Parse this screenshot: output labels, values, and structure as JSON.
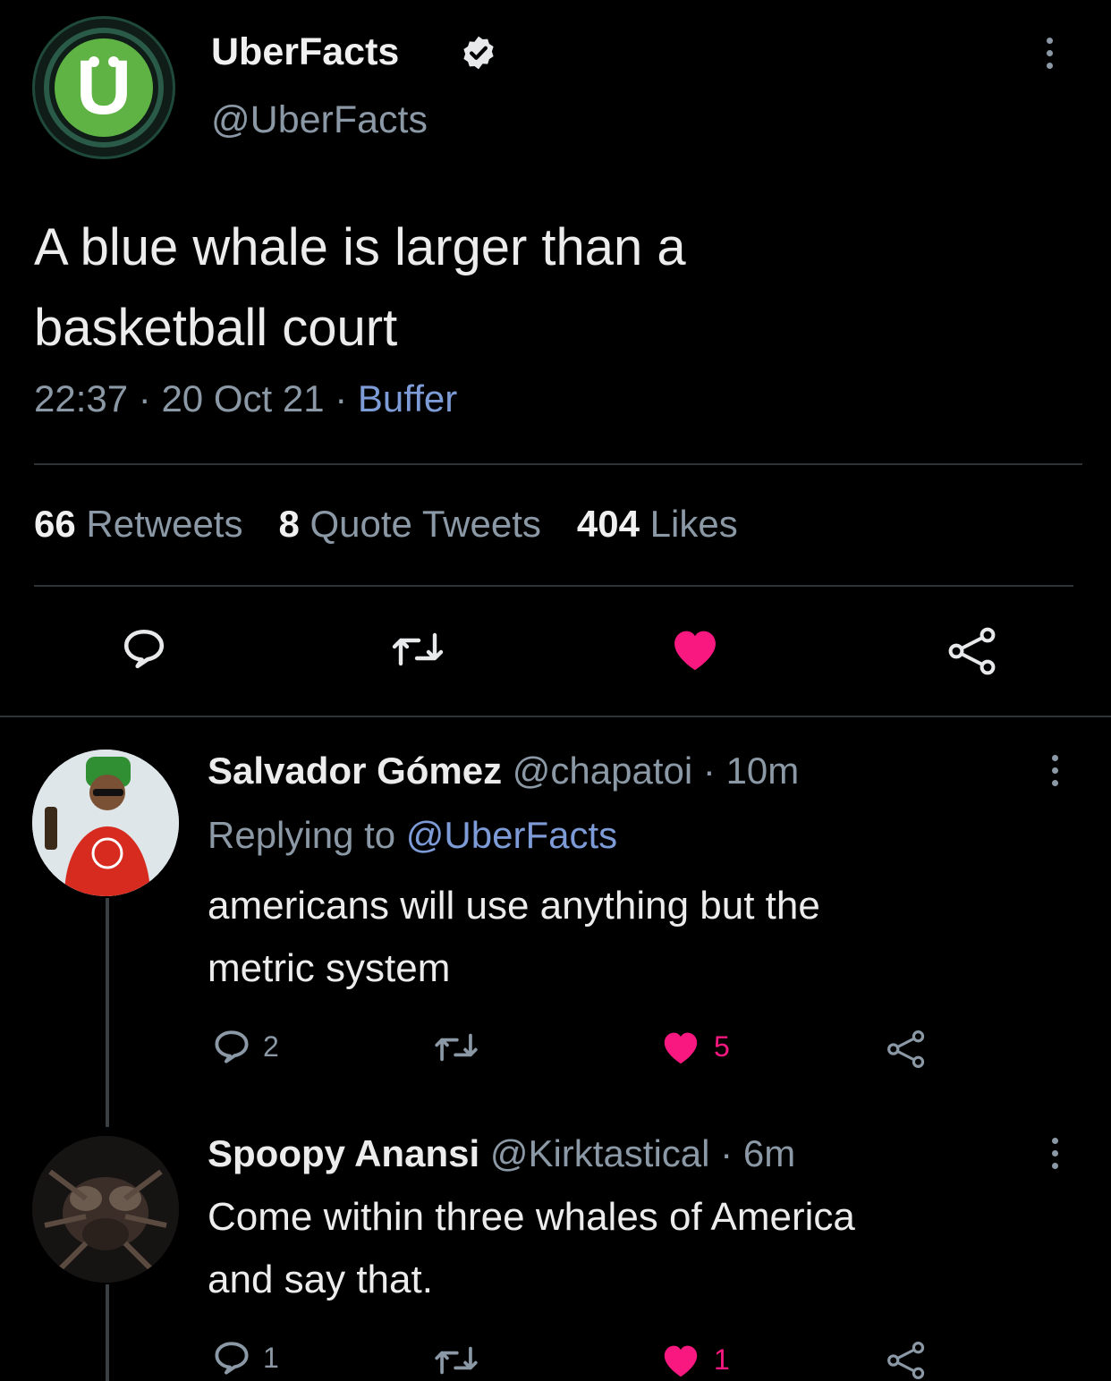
{
  "main_tweet": {
    "author_name": "UberFacts",
    "author_handle": "@UberFacts",
    "text_line1": "A blue whale is larger than a",
    "text_line2": "basketball court",
    "time": "22:37",
    "date": "20 Oct 21",
    "source": "Buffer",
    "separator": "·",
    "stats": {
      "retweets_count": "66",
      "retweets_label": "Retweets",
      "quotes_count": "8",
      "quotes_label": "Quote Tweets",
      "likes_count": "404",
      "likes_label": "Likes"
    },
    "liked": true
  },
  "replies": [
    {
      "author_name": "Salvador Gómez",
      "author_handle": "@chapatoi",
      "time_ago": "10m",
      "replying_to_label": "Replying to",
      "replying_to_handle": "@UberFacts",
      "text_line1": "americans will use anything but the",
      "text_line2": "metric system",
      "reply_count": "2",
      "like_count": "5",
      "liked": true
    },
    {
      "author_name": "Spoopy Anansi",
      "author_handle": "@Kirktastical",
      "time_ago": "6m",
      "text_line1": "Come within three whales of America",
      "text_line2": "and say that.",
      "reply_count": "1",
      "like_count": "1",
      "liked": true
    }
  ],
  "colors": {
    "background": "#000000",
    "like": "#f91880",
    "muted": "#8b98a5",
    "link": "#7d9bd6"
  }
}
